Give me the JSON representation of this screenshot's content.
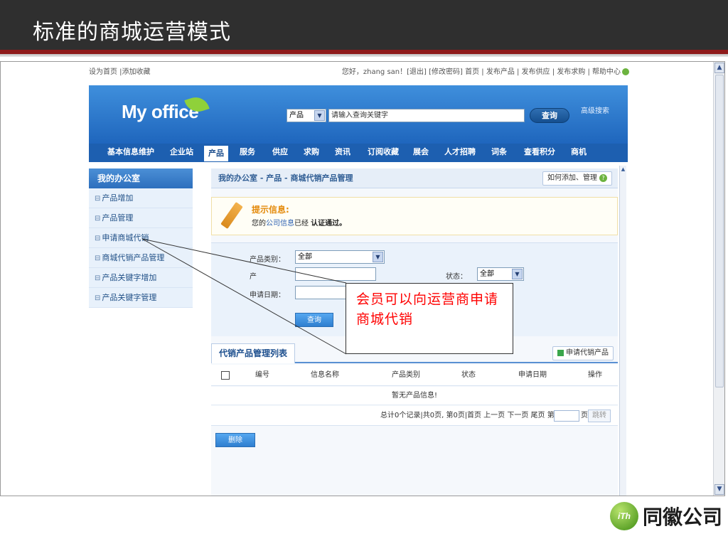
{
  "slide": {
    "title": "标准的商城运营模式"
  },
  "toplinks": {
    "left": "设为首页 |添加收藏",
    "right": "您好，zhang san！[退出] [修改密码]  首页 | 发布产品 | 发布供应 | 发布求购 | 帮助中心"
  },
  "header": {
    "logo": "My office",
    "search": {
      "category": "产品",
      "dropdown_arrow": "▼",
      "input_value": "请输入查询关键字",
      "button": "查询",
      "advanced": "高级搜索"
    }
  },
  "nav": {
    "items": [
      "基本信息维护",
      "企业站",
      "产品",
      "服务",
      "供应",
      "求购",
      "资讯",
      "订阅收藏",
      "展会",
      "人才招聘",
      "词条",
      "查看积分",
      "商机"
    ],
    "active": "产品"
  },
  "sidebar": {
    "title": "我的办公室",
    "bullet": "⊟",
    "items": [
      {
        "label": "产品增加"
      },
      {
        "label": "产品管理"
      },
      {
        "label": "申请商城代销"
      },
      {
        "label": "商城代销产品管理"
      },
      {
        "label": "产品关键字增加"
      },
      {
        "label": "产品关键字管理"
      }
    ]
  },
  "main": {
    "breadcrumb": "我的办公室 - 产品 - 商城代销产品管理",
    "howto_button": "如何添加、管理",
    "notice": {
      "title": "提示信息:",
      "text_prefix": "您的",
      "text_link": "公司信息",
      "text_middle": "已经 ",
      "text_bold": "认证通过。"
    },
    "form": {
      "category_label": "产品类别：",
      "category_value": "全部",
      "name_label": "产",
      "status_label": "状态：",
      "status_value": "全部",
      "date_label": "申请日期：",
      "query_button": "查询",
      "arrow": "▼"
    },
    "list": {
      "title": "代销产品管理列表",
      "apply_button": "申请代销产品",
      "columns": [
        "编号",
        "信息名称",
        "产品类别",
        "状态",
        "申请日期",
        "操作"
      ],
      "empty_text": "暂无产品信息!",
      "pager_info": "总计0个记录|共0页, 第0页|",
      "pager_links": "首页 上一页 下一页 尾页 第",
      "pager_page": "页",
      "go_button": "跳转",
      "delete_button": "删除"
    }
  },
  "callout": {
    "text": "会员可以向运营商申请商城代销"
  },
  "brand": {
    "badge": "iTh",
    "name": "同徽公司"
  },
  "scrollbar": {
    "up": "▲",
    "down": "▼"
  },
  "colors": {
    "header_bg": "#2f2f2f",
    "accent_red": "#8e1a1a",
    "nav_blue": "#1d5fb0",
    "callout_text": "#ff0000"
  }
}
